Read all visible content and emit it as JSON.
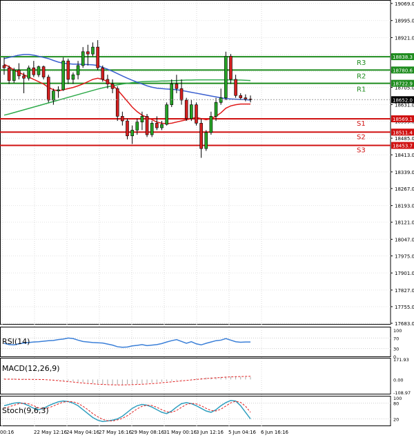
{
  "chart_data": {
    "type": "candlestick",
    "instrument_note": "",
    "price_axis": {
      "ticks": [
        "19069.0",
        "18995.0",
        "18921.0",
        "18847.0",
        "18775.0",
        "18705.0",
        "18631.0",
        "18559.0",
        "18485.0",
        "18413.0",
        "18339.0",
        "18267.0",
        "18193.0",
        "18121.0",
        "18047.0",
        "17975.0",
        "17901.0",
        "17827.0",
        "17755.0",
        "17683.0"
      ],
      "ylim": [
        17683.0,
        19069.0
      ]
    },
    "time_axis": {
      "ticks": [
        "00:16",
        "22 May 12:16",
        "24 May 04:16",
        "27 May 16:16",
        "29 May 08:16",
        "31 May 00:16",
        "3 Jun 12:16",
        "5 Jun 04:16",
        "6 Jun 16:16"
      ]
    },
    "levels": [
      {
        "name": "R3",
        "value": "18838.3",
        "color": "#1e8c1e"
      },
      {
        "name": "R2",
        "value": "18780.6",
        "color": "#1e8c1e"
      },
      {
        "name": "R1",
        "value": "18722.9",
        "color": "#1e8c1e"
      },
      {
        "name": "S1",
        "value": "18569.1",
        "color": "#d01010"
      },
      {
        "name": "S2",
        "value": "18511.4",
        "color": "#d01010"
      },
      {
        "name": "S3",
        "value": "18453.7",
        "color": "#d01010"
      }
    ],
    "current_price": "18652.0",
    "candles": [
      {
        "o": 18800,
        "h": 18835,
        "l": 18760,
        "c": 18790
      },
      {
        "o": 18790,
        "h": 18800,
        "l": 18720,
        "c": 18735
      },
      {
        "o": 18735,
        "h": 18790,
        "l": 18725,
        "c": 18780
      },
      {
        "o": 18780,
        "h": 18810,
        "l": 18740,
        "c": 18755
      },
      {
        "o": 18755,
        "h": 18770,
        "l": 18680,
        "c": 18745
      },
      {
        "o": 18745,
        "h": 18800,
        "l": 18735,
        "c": 18790
      },
      {
        "o": 18790,
        "h": 18820,
        "l": 18750,
        "c": 18760
      },
      {
        "o": 18760,
        "h": 18800,
        "l": 18750,
        "c": 18795
      },
      {
        "o": 18795,
        "h": 18800,
        "l": 18740,
        "c": 18750
      },
      {
        "o": 18750,
        "h": 18760,
        "l": 18640,
        "c": 18650
      },
      {
        "o": 18650,
        "h": 18700,
        "l": 18630,
        "c": 18690
      },
      {
        "o": 18690,
        "h": 18710,
        "l": 18660,
        "c": 18695
      },
      {
        "o": 18695,
        "h": 18835,
        "l": 18690,
        "c": 18820
      },
      {
        "o": 18820,
        "h": 18830,
        "l": 18720,
        "c": 18740
      },
      {
        "o": 18740,
        "h": 18770,
        "l": 18720,
        "c": 18760
      },
      {
        "o": 18760,
        "h": 18820,
        "l": 18740,
        "c": 18800
      },
      {
        "o": 18800,
        "h": 18880,
        "l": 18790,
        "c": 18860
      },
      {
        "o": 18860,
        "h": 18890,
        "l": 18800,
        "c": 18850
      },
      {
        "o": 18850,
        "h": 18900,
        "l": 18840,
        "c": 18880
      },
      {
        "o": 18880,
        "h": 18910,
        "l": 18780,
        "c": 18790
      },
      {
        "o": 18790,
        "h": 18800,
        "l": 18730,
        "c": 18740
      },
      {
        "o": 18740,
        "h": 18760,
        "l": 18700,
        "c": 18720
      },
      {
        "o": 18720,
        "h": 18740,
        "l": 18680,
        "c": 18700
      },
      {
        "o": 18700,
        "h": 18710,
        "l": 18560,
        "c": 18580
      },
      {
        "o": 18580,
        "h": 18600,
        "l": 18540,
        "c": 18560
      },
      {
        "o": 18560,
        "h": 18570,
        "l": 18480,
        "c": 18495
      },
      {
        "o": 18495,
        "h": 18540,
        "l": 18460,
        "c": 18520
      },
      {
        "o": 18520,
        "h": 18570,
        "l": 18500,
        "c": 18555
      },
      {
        "o": 18555,
        "h": 18600,
        "l": 18520,
        "c": 18580
      },
      {
        "o": 18580,
        "h": 18590,
        "l": 18490,
        "c": 18500
      },
      {
        "o": 18500,
        "h": 18560,
        "l": 18490,
        "c": 18550
      },
      {
        "o": 18550,
        "h": 18580,
        "l": 18520,
        "c": 18530
      },
      {
        "o": 18530,
        "h": 18560,
        "l": 18520,
        "c": 18545
      },
      {
        "o": 18545,
        "h": 18640,
        "l": 18540,
        "c": 18630
      },
      {
        "o": 18630,
        "h": 18740,
        "l": 18620,
        "c": 18720
      },
      {
        "o": 18720,
        "h": 18760,
        "l": 18680,
        "c": 18700
      },
      {
        "o": 18700,
        "h": 18740,
        "l": 18630,
        "c": 18650
      },
      {
        "o": 18650,
        "h": 18660,
        "l": 18560,
        "c": 18570
      },
      {
        "o": 18570,
        "h": 18650,
        "l": 18560,
        "c": 18630
      },
      {
        "o": 18630,
        "h": 18640,
        "l": 18540,
        "c": 18550
      },
      {
        "o": 18550,
        "h": 18570,
        "l": 18400,
        "c": 18440
      },
      {
        "o": 18440,
        "h": 18520,
        "l": 18430,
        "c": 18510
      },
      {
        "o": 18510,
        "h": 18600,
        "l": 18500,
        "c": 18580
      },
      {
        "o": 18580,
        "h": 18660,
        "l": 18560,
        "c": 18640
      },
      {
        "o": 18640,
        "h": 18700,
        "l": 18630,
        "c": 18660
      },
      {
        "o": 18660,
        "h": 18860,
        "l": 18650,
        "c": 18840
      },
      {
        "o": 18840,
        "h": 18850,
        "l": 18720,
        "c": 18740
      },
      {
        "o": 18740,
        "h": 18760,
        "l": 18660,
        "c": 18670
      },
      {
        "o": 18670,
        "h": 18680,
        "l": 18650,
        "c": 18660
      },
      {
        "o": 18660,
        "h": 18675,
        "l": 18645,
        "c": 18655
      },
      {
        "o": 18655,
        "h": 18670,
        "l": 18640,
        "c": 18652
      }
    ],
    "ma_fast": [
      18805,
      18795,
      18780,
      18770,
      18760,
      18750,
      18740,
      18730,
      18720,
      18705,
      18695,
      18690,
      18695,
      18700,
      18705,
      18712,
      18720,
      18730,
      18740,
      18745,
      18740,
      18730,
      18715,
      18695,
      18670,
      18645,
      18620,
      18600,
      18585,
      18575,
      18565,
      18555,
      18550,
      18548,
      18550,
      18555,
      18560,
      18565,
      18570,
      18575,
      18570,
      18565,
      18570,
      18580,
      18595,
      18615,
      18625,
      18630,
      18633,
      18633,
      18633
    ],
    "ma_mid": [
      18830,
      18835,
      18840,
      18845,
      18848,
      18848,
      18845,
      18840,
      18835,
      18830,
      18822,
      18815,
      18810,
      18808,
      18806,
      18806,
      18805,
      18804,
      18803,
      18800,
      18792,
      18784,
      18775,
      18765,
      18755,
      18745,
      18736,
      18728,
      18720,
      18712,
      18706,
      18702,
      18700,
      18698,
      18697,
      18695,
      18692,
      18688,
      18684,
      18680,
      18676,
      18672,
      18668,
      18664,
      18660,
      18657,
      18655,
      18654,
      18653,
      18652,
      18650
    ],
    "ma_slow": [
      18585,
      18590,
      18596,
      18602,
      18608,
      18614,
      18620,
      18626,
      18632,
      18638,
      18644,
      18650,
      18656,
      18662,
      18668,
      18674,
      18680,
      18686,
      18692,
      18698,
      18703,
      18708,
      18712,
      18716,
      18720,
      18723,
      18726,
      18728,
      18730,
      18731,
      18732,
      18732,
      18733,
      18733,
      18734,
      18735,
      18736,
      18737,
      18737,
      18738,
      18738,
      18738,
      18738,
      18738,
      18738,
      18738,
      18738,
      18737,
      18737,
      18736,
      18735
    ],
    "indicators": {
      "rsi": {
        "label": "RSI(14)",
        "ticks": [
          "100",
          "70",
          "30",
          "0"
        ],
        "ylim": [
          0,
          100
        ],
        "values": [
          50,
          45,
          44,
          48,
          51,
          53,
          55,
          56,
          58,
          60,
          61,
          64,
          66,
          70,
          68,
          62,
          57,
          55,
          53,
          52,
          51,
          47,
          43,
          37,
          35,
          36,
          40,
          42,
          45,
          41,
          43,
          45,
          49,
          55,
          60,
          64,
          57,
          50,
          56,
          48,
          44,
          50,
          55,
          60,
          62,
          68,
          62,
          56,
          54,
          55,
          55
        ]
      },
      "macd": {
        "label": "MACD(12,26,9)",
        "ticks": [
          "171.93",
          "0.00",
          "-108.97"
        ],
        "ylim": [
          -108.97,
          171.93
        ],
        "histogram": [
          10,
          9,
          8,
          8,
          7,
          6,
          5,
          4,
          2,
          0,
          -2,
          -5,
          -8,
          -12,
          -16,
          -20,
          -24,
          -28,
          -32,
          -36,
          -40,
          -42,
          -44,
          -45,
          -44,
          -42,
          -40,
          -38,
          -35,
          -32,
          -28,
          -24,
          -20,
          -16,
          -12,
          -8,
          -4,
          0,
          4,
          8,
          12,
          16,
          18,
          20,
          22,
          24,
          24,
          23,
          22,
          21,
          20
        ],
        "signal": [
          2,
          2,
          2,
          1,
          1,
          1,
          0,
          0,
          -1,
          -3,
          -6,
          -10,
          -14,
          -18,
          -22,
          -26,
          -30,
          -34,
          -37,
          -40,
          -42,
          -44,
          -45,
          -46,
          -46,
          -45,
          -44,
          -42,
          -40,
          -38,
          -35,
          -32,
          -28,
          -24,
          -20,
          -16,
          -12,
          -8,
          -4,
          0,
          4,
          8,
          11,
          14,
          17,
          20,
          22,
          24,
          25,
          26,
          27
        ]
      },
      "stoch": {
        "label": "Stoch(9,6,3)",
        "ticks": [
          "100",
          "80",
          "20"
        ],
        "ylim": [
          0,
          100
        ],
        "k": [
          70,
          75,
          80,
          82,
          78,
          70,
          60,
          55,
          60,
          70,
          78,
          85,
          88,
          86,
          80,
          70,
          55,
          40,
          25,
          15,
          10,
          12,
          15,
          20,
          30,
          45,
          60,
          70,
          75,
          72,
          65,
          55,
          45,
          40,
          50,
          65,
          78,
          82,
          78,
          70,
          60,
          50,
          45,
          55,
          70,
          82,
          90,
          88,
          70,
          45,
          20
        ],
        "d": [
          60,
          66,
          72,
          78,
          80,
          77,
          70,
          62,
          58,
          62,
          69,
          77,
          84,
          86,
          85,
          79,
          68,
          55,
          40,
          28,
          18,
          13,
          12,
          16,
          22,
          32,
          45,
          58,
          68,
          72,
          71,
          64,
          55,
          47,
          45,
          52,
          64,
          75,
          79,
          77,
          70,
          60,
          52,
          50,
          57,
          69,
          81,
          87,
          83,
          68,
          45
        ]
      }
    }
  }
}
